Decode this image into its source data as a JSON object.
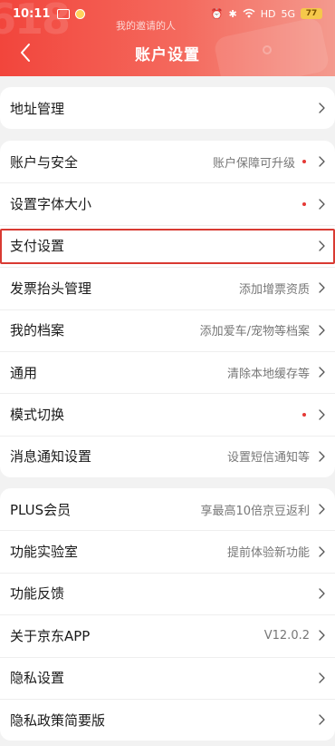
{
  "status_bar": {
    "time": "10:11",
    "ticker": "我的邀请的人",
    "network": "HD",
    "signal": "5G",
    "battery": "77"
  },
  "nav": {
    "title": "账户设置"
  },
  "groups": [
    {
      "rows": [
        {
          "name": "address",
          "label": "地址管理",
          "hint": "",
          "dot": false
        }
      ]
    },
    {
      "rows": [
        {
          "name": "account-security",
          "label": "账户与安全",
          "hint": "账户保障可升级",
          "dot": true
        },
        {
          "name": "font-size",
          "label": "设置字体大小",
          "hint": "",
          "dot": true
        },
        {
          "name": "payment-settings",
          "label": "支付设置",
          "hint": "",
          "dot": false
        },
        {
          "name": "invoice-header",
          "label": "发票抬头管理",
          "hint": "添加增票资质",
          "dot": false
        },
        {
          "name": "my-profile",
          "label": "我的档案",
          "hint": "添加爱车/宠物等档案",
          "dot": false
        },
        {
          "name": "general",
          "label": "通用",
          "hint": "清除本地缓存等",
          "dot": false
        },
        {
          "name": "mode-switch",
          "label": "模式切换",
          "hint": "",
          "dot": true
        },
        {
          "name": "notification",
          "label": "消息通知设置",
          "hint": "设置短信通知等",
          "dot": false
        }
      ]
    },
    {
      "rows": [
        {
          "name": "plus-member",
          "label": "PLUS会员",
          "hint": "享最高10倍京豆返利",
          "dot": false
        },
        {
          "name": "feature-lab",
          "label": "功能实验室",
          "hint": "提前体验新功能",
          "dot": false
        },
        {
          "name": "feedback",
          "label": "功能反馈",
          "hint": "",
          "dot": false
        },
        {
          "name": "about",
          "label": "关于京东APP",
          "hint": "V12.0.2",
          "dot": false
        },
        {
          "name": "privacy-settings",
          "label": "隐私设置",
          "hint": "",
          "dot": false
        },
        {
          "name": "privacy-policy",
          "label": "隐私政策简要版",
          "hint": "",
          "dot": false
        }
      ]
    }
  ],
  "colors": {
    "header_start": "#f2453c",
    "header_end": "#f49a8e",
    "highlight": "#d93a32",
    "dot": "#e53935"
  }
}
